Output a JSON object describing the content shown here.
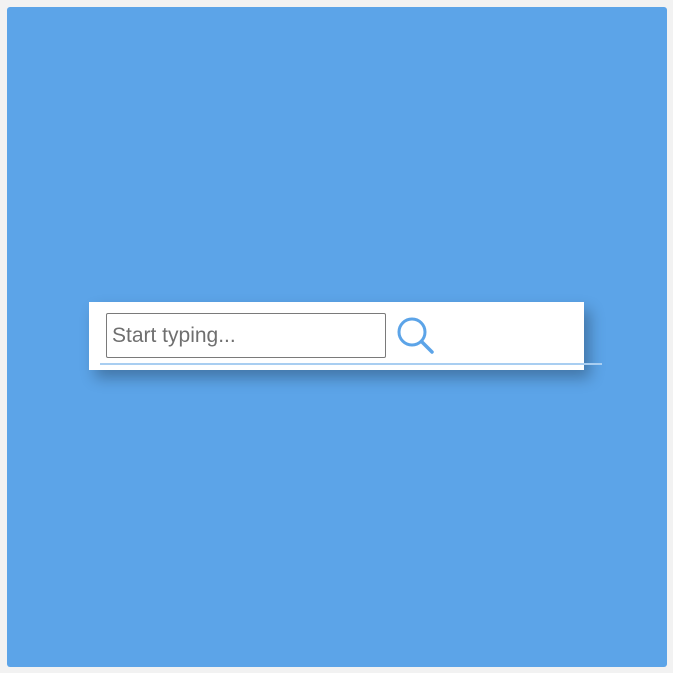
{
  "search": {
    "placeholder": "Start typing...",
    "value": "",
    "button_icon": "search-icon"
  },
  "colors": {
    "background": "#5ca4e8",
    "card": "#ffffff",
    "icon": "#5ca4e8",
    "underline": "#a9cef1"
  }
}
